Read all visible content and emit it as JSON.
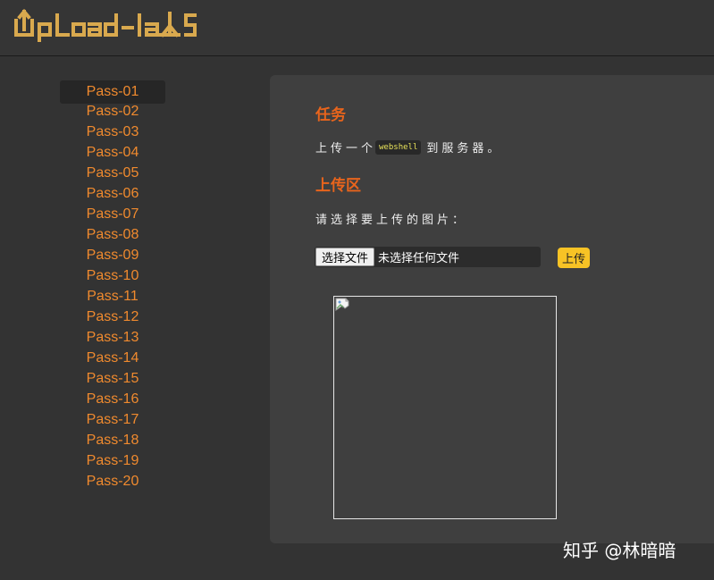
{
  "header": {
    "logo_text": "UpLoad-labs"
  },
  "sidebar": {
    "items": [
      {
        "label": "Pass-01",
        "active": true
      },
      {
        "label": "Pass-02"
      },
      {
        "label": "Pass-03"
      },
      {
        "label": "Pass-04"
      },
      {
        "label": "Pass-05"
      },
      {
        "label": "Pass-06"
      },
      {
        "label": "Pass-07"
      },
      {
        "label": "Pass-08"
      },
      {
        "label": "Pass-09"
      },
      {
        "label": "Pass-10"
      },
      {
        "label": "Pass-11"
      },
      {
        "label": "Pass-12"
      },
      {
        "label": "Pass-13"
      },
      {
        "label": "Pass-14"
      },
      {
        "label": "Pass-15"
      },
      {
        "label": "Pass-16"
      },
      {
        "label": "Pass-17"
      },
      {
        "label": "Pass-18"
      },
      {
        "label": "Pass-19"
      },
      {
        "label": "Pass-20"
      }
    ]
  },
  "task": {
    "title": "任务",
    "text_before": "上传一个",
    "code": "webshell",
    "text_after": "到服务器。"
  },
  "upload": {
    "title": "上传区",
    "prompt": "请选择要上传的图片：",
    "choose_label": "选择文件",
    "file_status": "未选择任何文件",
    "submit_label": "上传"
  },
  "preview": {
    "icon": "broken-image-icon"
  },
  "watermark": {
    "text": "知乎 @林暗暗"
  },
  "colors": {
    "accent_orange": "#f08a2e",
    "title_orange": "#e8641c",
    "logo_gold": "#d9a94e",
    "button_yellow": "#f7c325",
    "code_yellow": "#e8e25a"
  }
}
